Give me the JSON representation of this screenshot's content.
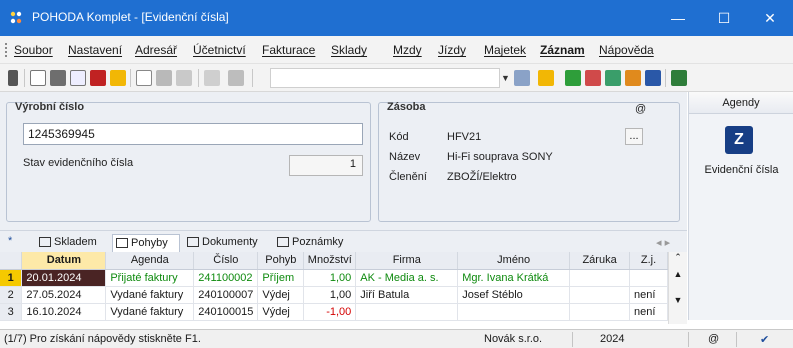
{
  "window": {
    "title": "POHODA Komplet - [Evidenční čísla]",
    "minimize": "—",
    "maximize": "☐",
    "close": "✕"
  },
  "menu": [
    "Soubor",
    "Nastavení",
    "Adresář",
    "Účetnictví",
    "Fakturace",
    "Sklady",
    "Mzdy",
    "Jízdy",
    "Majetek",
    "Záznam",
    "Nápověda"
  ],
  "toolbar": {
    "combo_value": ""
  },
  "form": {
    "serial_title": "Výrobní číslo",
    "serial_value": "1245369945",
    "status_label": "Stav evidenčního čísla",
    "status_value": "1",
    "zasoba_title": "Zásoba",
    "zasoba_at": "@",
    "kod_label": "Kód",
    "kod_value": "HFV21",
    "nazev_label": "Název",
    "nazev_value": "Hi-Fi souprava SONY",
    "cleneni_label": "Členění",
    "cleneni_value": "ZBOŽÍ/Elektro",
    "browse_button": "..."
  },
  "agendy": {
    "title": "Agendy",
    "tile_letter": "Z",
    "item_label": "Evidenční čísla"
  },
  "tabs": [
    "Skladem",
    "Pohyby",
    "Dokumenty",
    "Poznámky"
  ],
  "tabs_star": "*",
  "grid": {
    "columns": [
      "Datum",
      "Agenda",
      "Číslo",
      "Pohyb",
      "Množství",
      "Firma",
      "Jméno",
      "Záruka",
      "Z.j."
    ],
    "rows": [
      {
        "idx": "1",
        "datum": "20.01.2024",
        "agenda": "Přijaté faktury",
        "cislo": "241100002",
        "pohyb": "Příjem",
        "mnozstvi": "1,00",
        "firma": "AK - Media a. s.",
        "jmeno": "Mgr. Ivana Krátká",
        "zaruka": "",
        "zj": ""
      },
      {
        "idx": "2",
        "datum": "27.05.2024",
        "agenda": "Vydané faktury",
        "cislo": "240100007",
        "pohyb": "Výdej",
        "mnozstvi": "1,00",
        "firma": "Jiří Batula",
        "jmeno": "Josef Stéblo",
        "zaruka": "",
        "zj": "není"
      },
      {
        "idx": "3",
        "datum": "16.10.2024",
        "agenda": "Vydané faktury",
        "cislo": "240100015",
        "pohyb": "Výdej",
        "mnozstvi": "-1,00",
        "firma": "",
        "jmeno": "",
        "zaruka": "",
        "zj": "není"
      }
    ]
  },
  "status": {
    "hint": "(1/7) Pro získání nápovědy stiskněte F1.",
    "company": "Novák s.r.o.",
    "year": "2024",
    "at": "@",
    "check": "✔"
  }
}
